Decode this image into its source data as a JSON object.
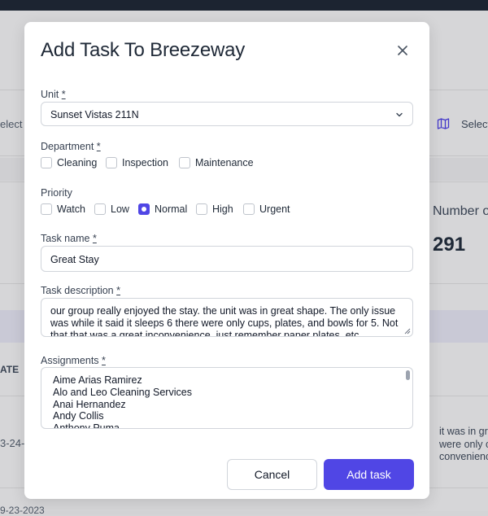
{
  "background": {
    "left_filter_text": "elect r",
    "right_select_text": "Select",
    "number_header": "Number o",
    "number_value": "291",
    "column_header": "ATE",
    "row_date": "3-24-",
    "row_date_bottom": "9-23-2023",
    "snippet_lines": [
      "it was in grea",
      "were only cup",
      "convenience,"
    ],
    "map_icon": "map-icon"
  },
  "modal": {
    "title": "Add Task To Breezeway",
    "close_icon": "close-icon",
    "unit": {
      "label": "Unit",
      "required": "*",
      "value": "Sunset Vistas 211N"
    },
    "department": {
      "label": "Department",
      "required": "*",
      "options": [
        "Cleaning",
        "Inspection",
        "Maintenance"
      ]
    },
    "priority": {
      "label": "Priority",
      "options": [
        "Watch",
        "Low",
        "Normal",
        "High",
        "Urgent"
      ],
      "selected": "Normal"
    },
    "task_name": {
      "label": "Task name",
      "required": "*",
      "value": "Great Stay"
    },
    "task_description": {
      "label": "Task description",
      "required": "*",
      "value": "our group really enjoyed the stay. the unit was in great shape. The only issue was while it said it sleeps 6 there were only cups, plates, and bowls for 5. Not that that was a great inconvenience, just remember paper plates, etc."
    },
    "assignments": {
      "label": "Assignments",
      "required": "*",
      "items": [
        "Aime Arias Ramirez",
        "Alo and Leo Cleaning Services",
        "Anai Hernandez",
        "Andy Collis",
        "Anthony Puma"
      ]
    },
    "buttons": {
      "cancel": "Cancel",
      "add": "Add task"
    }
  },
  "colors": {
    "accent": "#5046e5",
    "topbar": "#1c2431",
    "backdrop": "#d6d6d8"
  }
}
